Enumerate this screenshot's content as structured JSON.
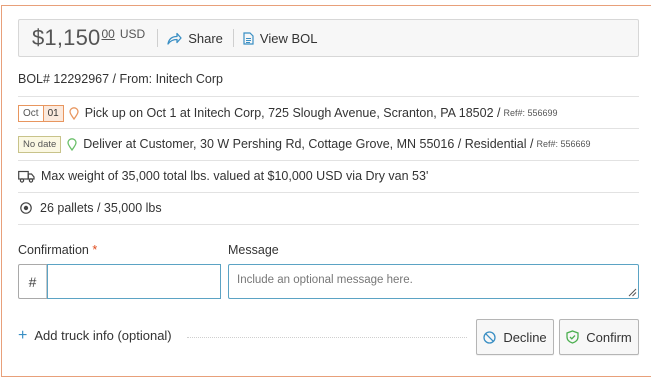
{
  "price": {
    "main": "$1,150",
    "cents": "00",
    "currency": "USD"
  },
  "toolbar": {
    "share_label": "Share",
    "view_bol_label": "View BOL"
  },
  "bol_line": "BOL# 12292967 / From: Initech Corp",
  "pickup": {
    "month": "Oct",
    "day": "01",
    "text": "Pick up on Oct 1 at Initech Corp, 725 Slough Avenue, Scranton, PA 18502 /",
    "ref": "Ref#: 556699"
  },
  "delivery": {
    "date_label": "No date",
    "text": "Deliver at Customer, 30 W Pershing Rd, Cottage Grove, MN 55016 / Residential /",
    "ref": "Ref#: 556669"
  },
  "weight_line": "Max weight of 35,000 total lbs. valued at $10,000 USD via Dry van 53'",
  "pallets_line": "26 pallets / 35,000 lbs",
  "form": {
    "confirmation_label": "Confirmation",
    "required_mark": "*",
    "hash": "#",
    "confirmation_value": "",
    "message_label": "Message",
    "message_placeholder": "Include an optional message here."
  },
  "actions": {
    "add_truck_label": "Add truck info (optional)",
    "decline_label": "Decline",
    "confirm_label": "Confirm"
  },
  "icons": {
    "share": "share-icon",
    "view_bol": "document-icon",
    "pickup_pin": "map-pin-icon",
    "delivery_pin": "map-pin-icon",
    "truck": "truck-icon",
    "pallets": "target-icon",
    "decline": "block-icon",
    "confirm": "shield-check-icon"
  },
  "colors": {
    "accent": "#e8965f",
    "link": "#3a8fc4",
    "confirm": "#4caf50",
    "pin_orange": "#e8965f",
    "pin_green": "#6abf69"
  }
}
